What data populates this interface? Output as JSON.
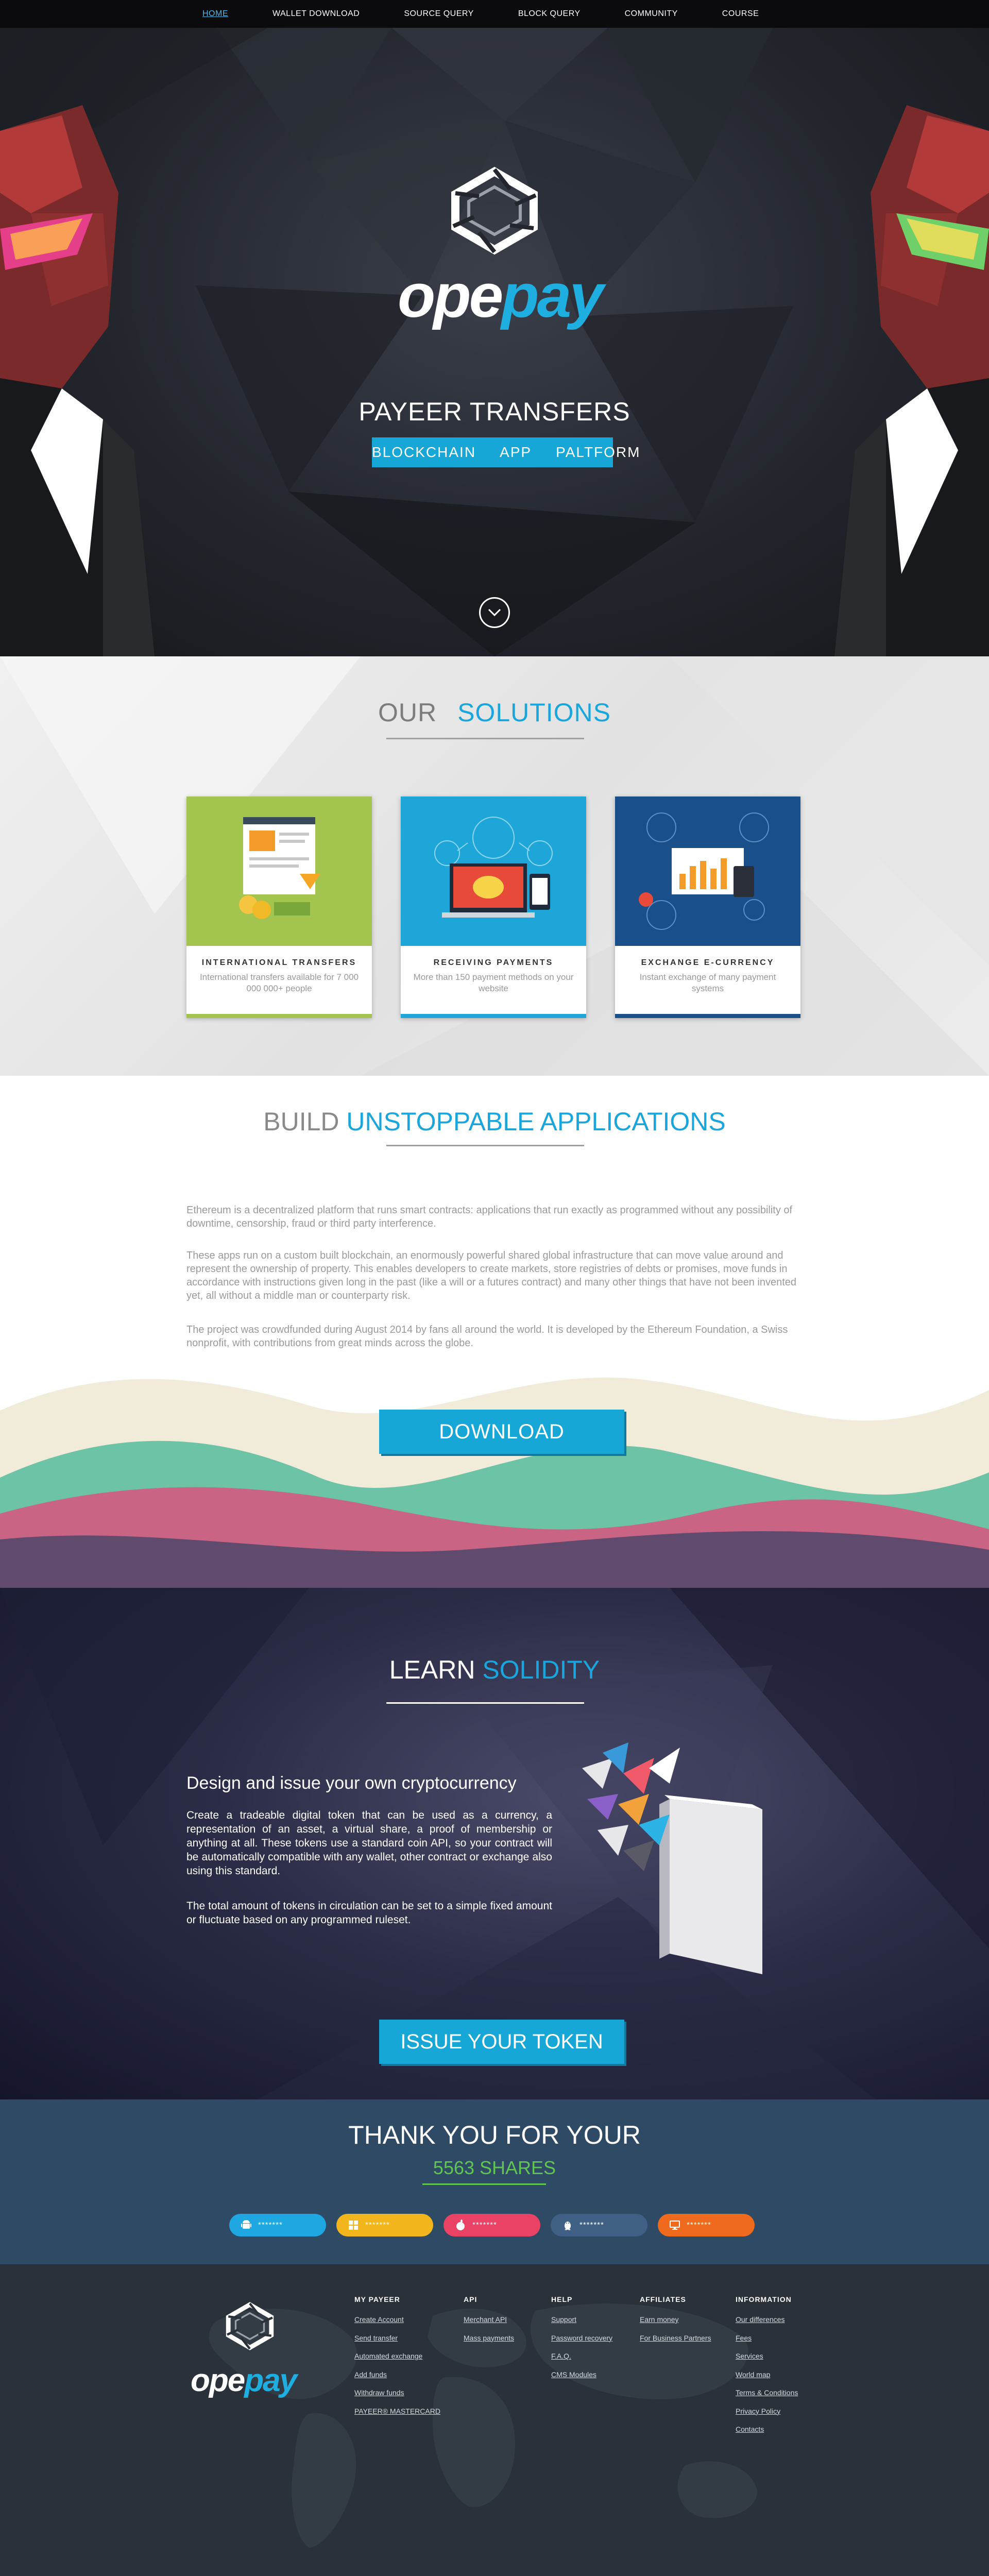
{
  "nav": {
    "items": [
      {
        "label": "HOME",
        "active": true
      },
      {
        "label": "WALLET DOWNLOAD",
        "active": false
      },
      {
        "label": "SOURCE QUERY",
        "active": false
      },
      {
        "label": "BLOCK QUERY",
        "active": false
      },
      {
        "label": "COMMUNITY",
        "active": false
      },
      {
        "label": "COURSE",
        "active": false
      }
    ]
  },
  "hero": {
    "brand_ope": "ope",
    "brand_pay": "pay",
    "title": "PAYEER TRANSFERS",
    "tagline": "BLOCKCHAIN  APP  PALTFORM"
  },
  "solutions": {
    "title_part1": "OUR",
    "title_part2": "SOLUTIONS",
    "cards": [
      {
        "title": "INTERNATIONAL TRANSFERS",
        "desc": "International transfers available for 7 000 000 000+ people",
        "color": "#a3c54f"
      },
      {
        "title": "RECEIVING PAYMENTS",
        "desc": "More than 150 payment methods on your website",
        "color": "#1fa6d9"
      },
      {
        "title": "EXCHANGE E-CURRENCY",
        "desc": "Instant exchange of many payment systems",
        "color": "#1b4f8a"
      }
    ]
  },
  "build": {
    "title_part1": "BUILD",
    "title_part2": "UNSTOPPABLE APPLICATIONS",
    "p1": "Ethereum is a decentralized platform that runs smart contracts: applications that run exactly as programmed without any possibility of downtime, censorship, fraud or third party interference.",
    "p2": "These apps run on a custom built blockchain, an enormously powerful shared global infrastructure that can move value around and represent the ownership of property. This enables developers to create markets, store registries of debts or promises, move funds in accordance with instructions given long in the past (like a will or a futures contract) and many other things that have not been invented yet, all without a middle man or counterparty risk.",
    "p3": "The project was crowdfunded during August 2014 by fans all around the world. It is developed by the Ethereum Foundation, a Swiss nonprofit, with contributions from great minds across the globe.",
    "download_label": "DOWNLOAD"
  },
  "learn": {
    "title_part1": "LEARN",
    "title_part2": "SOLIDITY",
    "heading": "Design and issue your own cryptocurrency",
    "p1": "Create a tradeable digital token that can be used as a currency, a representation of an asset, a virtual share, a proof of membership or anything at all. These tokens use a standard coin API, so your contract will be automatically compatible with any wallet, other contract or exchange also using this standard.",
    "p2": "The total amount of tokens in circulation can be set to a simple fixed amount or fluctuate based on any programmed ruleset.",
    "issue_label": "ISSUE YOUR TOKEN"
  },
  "thanks": {
    "title": "THANK YOU FOR YOUR",
    "shares": "5563 SHARES",
    "buttons": [
      {
        "icon": "android-icon",
        "label": "*******",
        "color": "#1ea7e1"
      },
      {
        "icon": "windows-icon",
        "label": "*******",
        "color": "#f2b51c"
      },
      {
        "icon": "apple-icon",
        "label": "*******",
        "color": "#ea4265"
      },
      {
        "icon": "linux-icon",
        "label": "*******",
        "color": "#3f5f85"
      },
      {
        "icon": "desktop-icon",
        "label": "*******",
        "color": "#ef6a1c"
      }
    ]
  },
  "footer": {
    "brand_ope": "ope",
    "brand_pay": "pay",
    "columns": [
      {
        "heading": "MY PAYEER",
        "links": [
          "Create Account",
          "Send transfer",
          "Automated exchange",
          "Add funds",
          "Withdraw funds",
          "PAYEER® MASTERCARD"
        ]
      },
      {
        "heading": "API",
        "links": [
          "Merchant API",
          "Mass payments"
        ]
      },
      {
        "heading": "HELP",
        "links": [
          "Support",
          "Password recovery",
          "F.A.Q.",
          "CMS Modules"
        ]
      },
      {
        "heading": "AFFILIATES",
        "links": [
          "Earn money",
          "For Business Partners"
        ]
      },
      {
        "heading": "INFORMATION",
        "links": [
          "Our differences",
          "Fees",
          "Services",
          "World map",
          "Terms & Conditions",
          "Privacy Policy",
          "Contacts"
        ]
      }
    ]
  }
}
